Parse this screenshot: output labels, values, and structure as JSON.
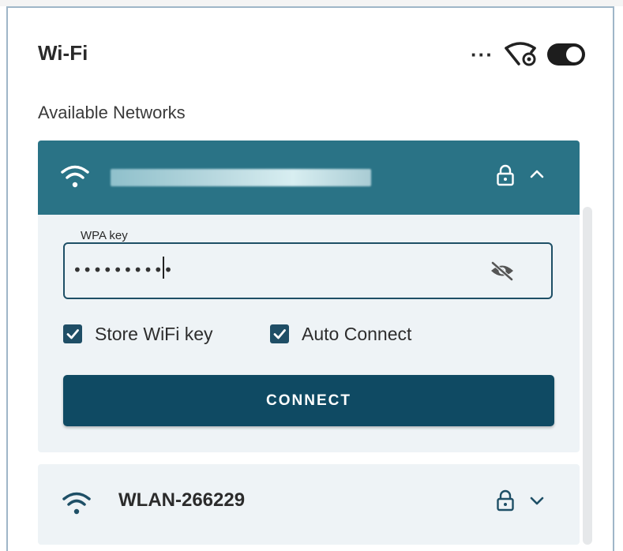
{
  "panel": {
    "title": "Wi-Fi",
    "more_label": "···",
    "subtitle": "Available Networks",
    "wifi_enabled": true
  },
  "icons": {
    "more": "more-horizontal-icon",
    "header_wifi_settings": "wifi-settings-icon",
    "toggle": "toggle-switch",
    "wifi": "wifi-icon",
    "lock": "lock-icon",
    "chevron_up": "chevron-up-icon",
    "chevron_down": "chevron-down-icon",
    "eye_off": "eye-off-icon",
    "check": "check-icon"
  },
  "networks": [
    {
      "ssid": "",
      "ssid_obscured": true,
      "secured": true,
      "expanded": true
    },
    {
      "ssid": "WLAN-266229",
      "secured": true,
      "expanded": false
    }
  ],
  "connect_form": {
    "key_label": "WPA key",
    "key_value": "••••••••••",
    "store_key_label": "Store WiFi key",
    "store_key_checked": true,
    "auto_connect_label": "Auto Connect",
    "auto_connect_checked": true,
    "connect_label": "CONNECT"
  },
  "colors": {
    "accent": "#2a7386",
    "primary_button": "#0f4a63",
    "card_bg": "#eef3f6"
  }
}
